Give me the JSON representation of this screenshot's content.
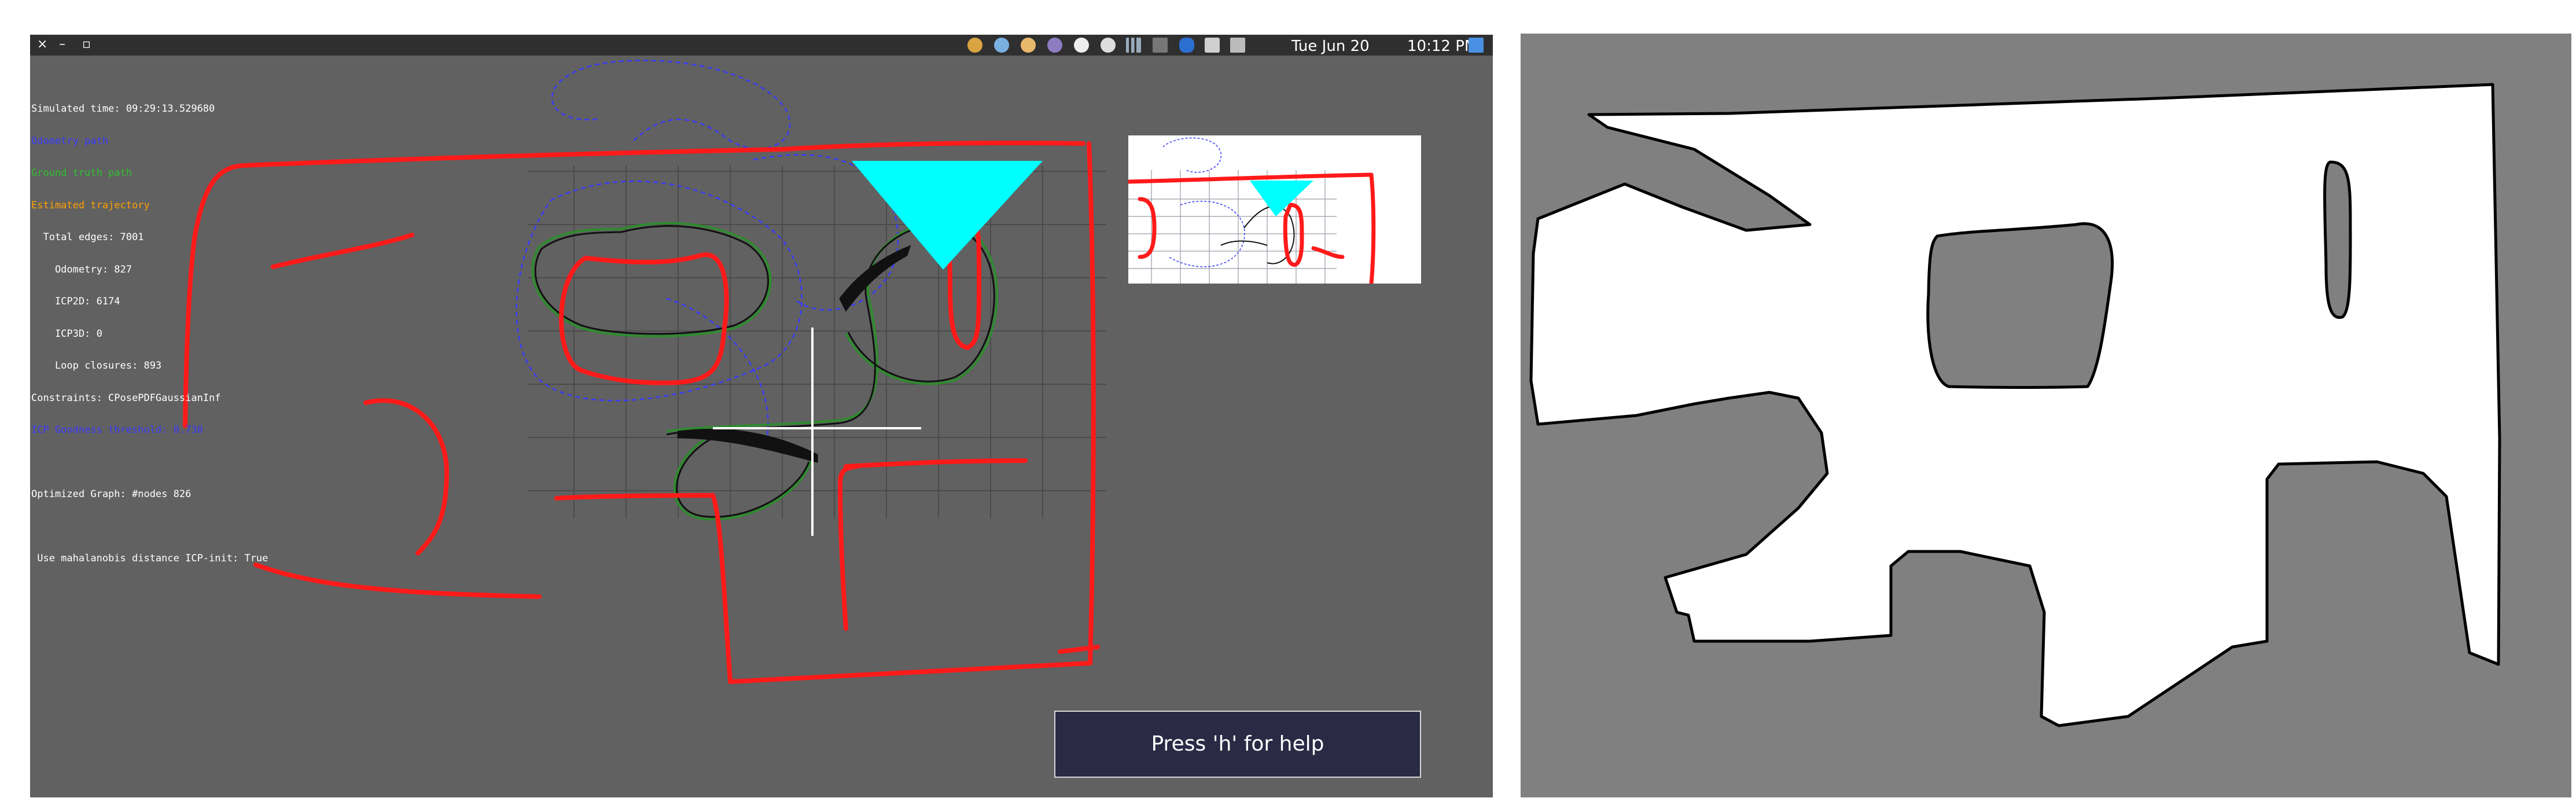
{
  "left_window": {
    "window_controls": {
      "close": "×",
      "minimize": "–",
      "maximize": "▫"
    },
    "tray": {
      "icons": [
        "browser-icon",
        "dropbox-icon",
        "onion-icon",
        "viber-icon",
        "connection-icon",
        "chromium-icon",
        "network-signal-icon",
        "keyboard-layout-icon",
        "bluetooth-icon",
        "clipboard-icon",
        "volume-icon",
        "monitor-icon"
      ],
      "date": "Tue Jun 20",
      "time": "10:12 PM"
    },
    "overlay_lines": [
      {
        "text": "Simulated time: 09:29:13.529680",
        "color": "#ffffff"
      },
      {
        "text": "Odometry path",
        "color": "#3a3aff"
      },
      {
        "text": "Ground truth path",
        "color": "#30c030"
      },
      {
        "text": "Estimated trajectory",
        "color": "#ffa200"
      },
      {
        "text": "  Total edges: 7001",
        "color": "#ffffff"
      },
      {
        "text": "    Odometry: 827",
        "color": "#ffffff"
      },
      {
        "text": "    ICP2D: 6174",
        "color": "#ffffff"
      },
      {
        "text": "    ICP3D: 0",
        "color": "#ffffff"
      },
      {
        "text": "    Loop closures: 893",
        "color": "#ffffff"
      },
      {
        "text": "Constraints: CPosePDFGaussianInf",
        "color": "#ffffff"
      },
      {
        "text": "ICP Goodness threshold: 0.730",
        "color": "#3a3aff"
      },
      {
        "text": "",
        "color": "#ffffff"
      },
      {
        "text": "Optimized Graph: #nodes 826",
        "color": "#ffffff"
      },
      {
        "text": "",
        "color": "#30c030"
      },
      {
        "text": " Use mahalanobis distance ICP-init: True",
        "color": "#ffffff"
      }
    ],
    "help_text": "Press 'h' for help",
    "colors": {
      "laser_points": "#ff1a1a",
      "odometry": "#3a3aff",
      "estimated": "#111111",
      "ground_truth": "#2e8b2e",
      "robot_fov": "#00ffff"
    }
  },
  "right_window": {
    "colors": {
      "free_space": "#ffffff",
      "unknown": "#808080",
      "occupied": "#000000"
    }
  }
}
